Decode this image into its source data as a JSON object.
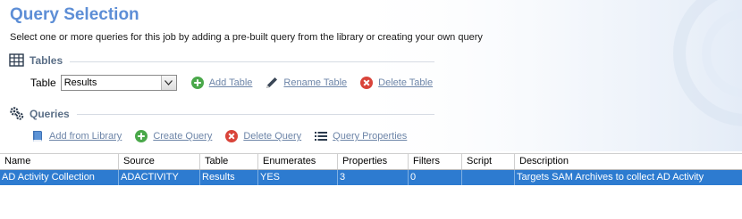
{
  "header": {
    "title": "Query Selection",
    "subtitle": "Select one or more queries for this job by adding a pre-built query from the library or creating your own query"
  },
  "tables_section": {
    "heading": "Tables",
    "icon": "table-grid-icon",
    "table_label": "Table",
    "table_select_value": "Results",
    "actions": {
      "add": "Add Table",
      "rename": "Rename Table",
      "delete": "Delete Table"
    }
  },
  "queries_section": {
    "heading": "Queries",
    "icon": "gears-icon",
    "actions": {
      "add_from_library": "Add from Library",
      "create": "Create Query",
      "delete": "Delete Query",
      "properties": "Query Properties"
    }
  },
  "grid": {
    "columns": [
      "Name",
      "Source",
      "Table",
      "Enumerates",
      "Properties",
      "Filters",
      "Script",
      "Description"
    ],
    "rows": [
      {
        "selected": true,
        "cells": [
          "AD Activity Collection",
          "ADACTIVITY",
          "Results",
          "YES",
          "3",
          "0",
          "",
          "Targets SAM Archives to collect AD Activity"
        ]
      }
    ]
  },
  "colors": {
    "title": "#5d8ed6",
    "section_heading": "#5b6f87",
    "link": "#6d85a8",
    "selection": "#2d7bd0",
    "add_green": "#4aa84a",
    "delete_red": "#d9443a"
  }
}
